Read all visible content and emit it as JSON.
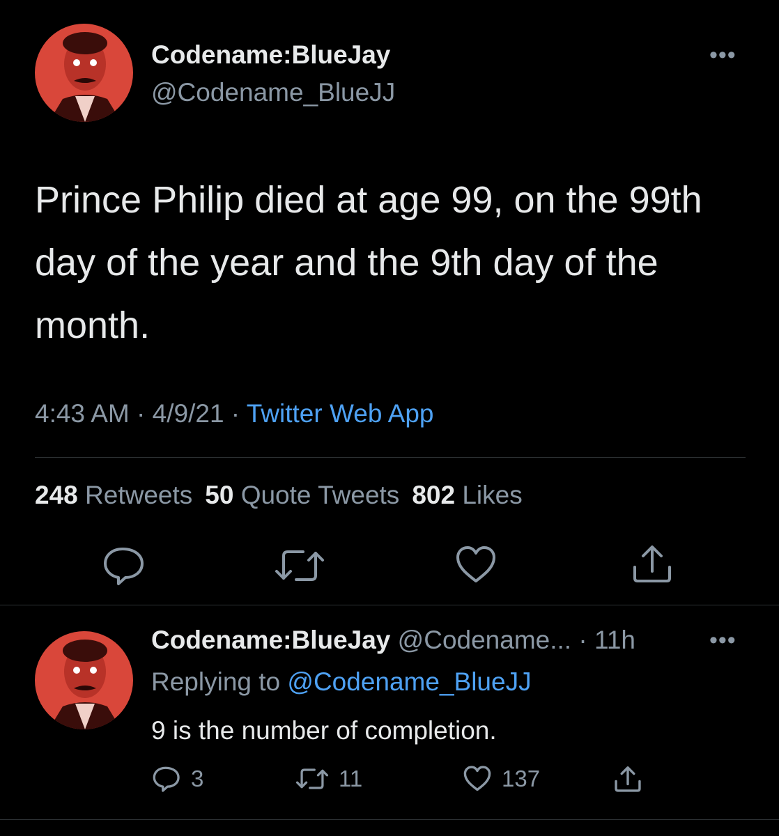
{
  "colors": {
    "background": "#000000",
    "text": "#e7e9ea",
    "muted": "#8b98a5",
    "link": "#4ea1f3",
    "divider": "#2f3336",
    "avatar_tint": "#d9473a"
  },
  "tweet": {
    "display_name": "Codename:BlueJay",
    "handle": "@Codename_BlueJJ",
    "more_icon": "more-dots-icon",
    "text": "Prince Philip died at age 99, on the 99th day of the year and the 9th day of the month.",
    "time": "4:43 AM",
    "sep1": " · ",
    "date": "4/9/21",
    "sep2": " · ",
    "app": "Twitter Web App",
    "stats": {
      "retweets_count": "248",
      "retweets_label": "Retweets",
      "quotes_count": "50",
      "quotes_label": "Quote Tweets",
      "likes_count": "802",
      "likes_label": "Likes"
    },
    "actions": [
      "reply-icon",
      "retweet-icon",
      "like-icon",
      "share-icon"
    ]
  },
  "reply": {
    "display_name": "Codename:BlueJay",
    "handle": "@Codename...",
    "sep": " · ",
    "age": "11h",
    "replying_prefix": "Replying to ",
    "replying_handle": "@Codename_BlueJJ",
    "text": "9 is the number of completion.",
    "counts": {
      "replies": "3",
      "retweets": "11",
      "likes": "137"
    }
  }
}
